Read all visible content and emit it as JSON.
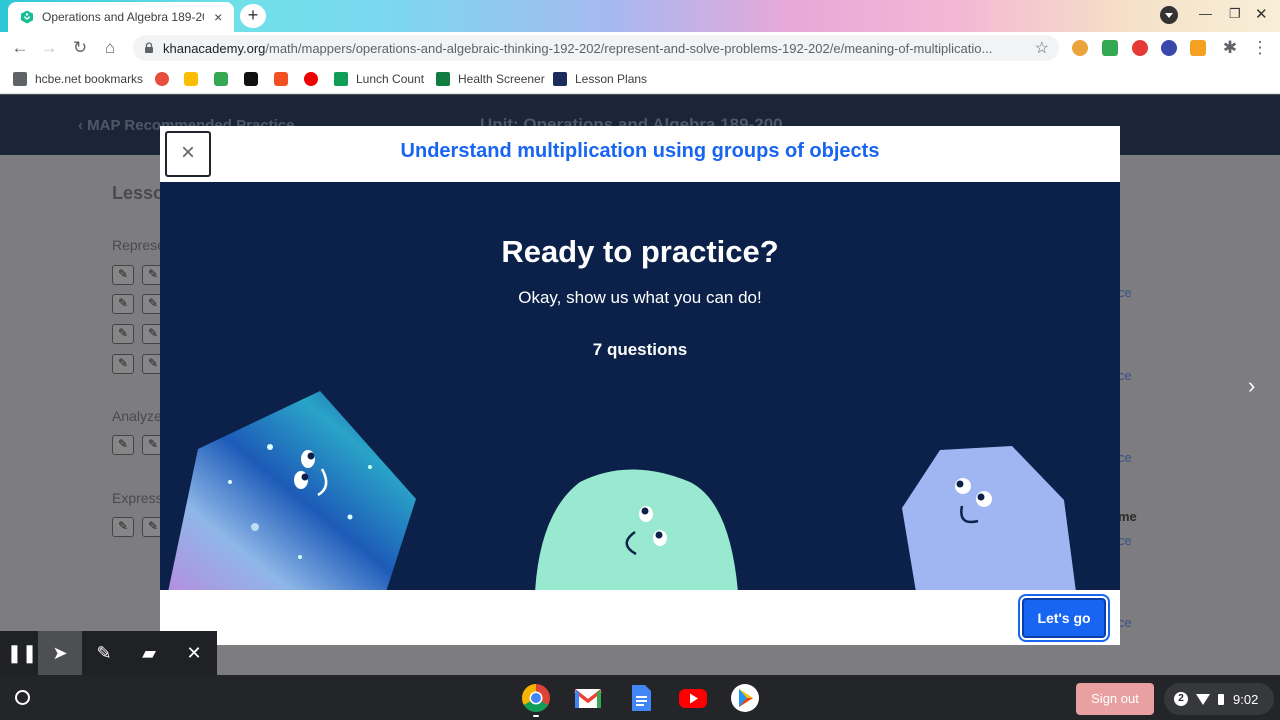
{
  "browser": {
    "tab_title": "Operations and Algebra 189-200",
    "tab_close": "×",
    "new_tab": "+",
    "url_host": "khanacademy.org",
    "url_path": "/math/mappers/operations-and-algebraic-thinking-192-202/represent-and-solve-problems-192-202/e/meaning-of-multiplicatio...",
    "bookmarks": [
      "hcbe.net bookmarks",
      "Lunch Count",
      "Health Screener",
      "Lesson Plans"
    ]
  },
  "page": {
    "breadcrumb": "MAP Recommended Practice",
    "unit_title": "Unit: Operations and Algebra 189-200",
    "lesson_heading": "Lesso",
    "sections": [
      "Represe",
      "Analyze",
      "Express"
    ],
    "right_links": [
      "ce",
      "ce",
      "ce",
      "ce",
      "ce"
    ],
    "right_bold": "me"
  },
  "modal": {
    "close_label": "×",
    "title": "Understand multiplication using groups of objects",
    "heading": "Ready to practice?",
    "subtitle": "Okay, show us what you can do!",
    "question_count": "7 questions",
    "go_label": "Let's go"
  },
  "shelf": {
    "sign_out": "Sign out",
    "notification_count": "2",
    "time": "9:02"
  },
  "colors": {
    "accent": "#1865f2",
    "modal_body_bg": "#0b2149",
    "page_header_bg": "#1b2538"
  }
}
